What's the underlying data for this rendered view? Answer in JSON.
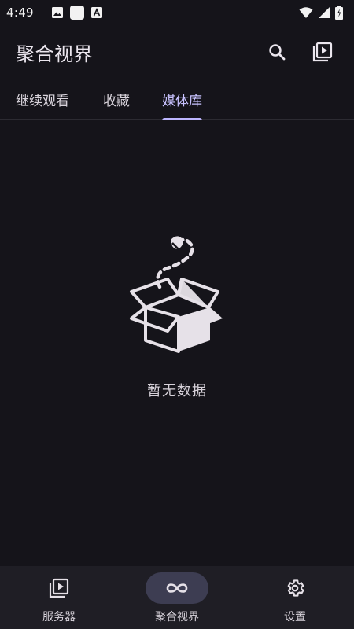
{
  "status_bar": {
    "time": "4:49",
    "left_icons": [
      "image-icon",
      "blank-square-icon",
      "app-notification-icon"
    ],
    "right_icons": [
      "wifi-icon",
      "cell-signal-icon",
      "battery-icon"
    ]
  },
  "app_bar": {
    "title": "聚合视界",
    "actions": [
      "search-icon",
      "play-library-icon"
    ]
  },
  "tabs": [
    {
      "label": "继续观看",
      "active": false
    },
    {
      "label": "收藏",
      "active": false
    },
    {
      "label": "媒体库",
      "active": true
    }
  ],
  "empty_state": {
    "icon": "open-box-icon",
    "message": "暂无数据"
  },
  "bottom_nav": [
    {
      "label": "服务器",
      "icon": "video-library-icon",
      "active": false
    },
    {
      "label": "聚合视界",
      "icon": "infinity-icon",
      "active": true
    },
    {
      "label": "设置",
      "icon": "gear-icon",
      "active": false
    }
  ],
  "colors": {
    "background": "#15141a",
    "accent": "#c8c2ff",
    "nav_background": "#1f1e25",
    "active_pill": "#3d3d52"
  }
}
